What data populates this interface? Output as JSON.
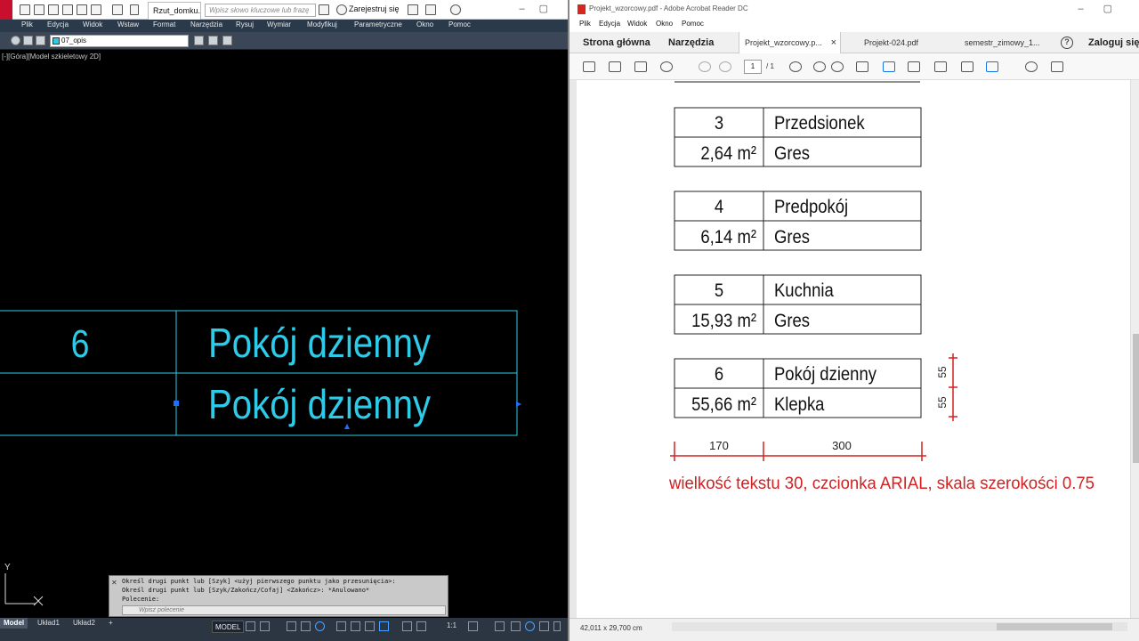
{
  "autocad": {
    "doc_tab": "Rzut_domku...",
    "search_placeholder": "Wpisz słowo kluczowe lub frazę",
    "signin": "Zarejestruj się",
    "menu": [
      "Plik",
      "Edycja",
      "Widok",
      "Wstaw",
      "Format",
      "Narzędzia",
      "Rysuj",
      "Wymiar",
      "Modyfikuj",
      "Parametryczne",
      "Okno",
      "Pomoc"
    ],
    "layer": "07_opis",
    "viewport_label": "[-][Góra][Model szkieletowy 2D]",
    "table": {
      "number": "6",
      "name": "Pokój dzienny",
      "name2": "Pokój dzienny"
    },
    "ucs": {
      "y": "Y",
      "x": "X"
    },
    "command_lines": [
      "Określ drugi punkt lub [Szyk] <użyj pierwszego punktu jako przesunięcia>:",
      "Określ drugi punkt lub [Szyk/Zakończ/Cofaj] <Zakończ>: *Anulowano*",
      "Polecenie:"
    ],
    "command_placeholder": "Wpisz polecenie",
    "layout_tabs": [
      "Model",
      "Układ1",
      "Układ2"
    ],
    "add_tab": "+",
    "model_button": "MODEL",
    "scale": "1:1",
    "accent_color": "#2ecbe8"
  },
  "acrobat": {
    "title": "Projekt_wzorcowy.pdf - Adobe Acrobat Reader DC",
    "menu": [
      "Plik",
      "Edycja",
      "Widok",
      "Okno",
      "Pomoc"
    ],
    "tabs": {
      "home": "Strona główna",
      "tools": "Narzędzia",
      "doc": "Projekt_wzorcowy.p...",
      "close": "×",
      "doc2": "Projekt-024.pdf",
      "doc3": "semestr_zimowy_1...",
      "signin": "Zaloguj się"
    },
    "page_current": "1",
    "page_total": "/ 1",
    "page_size": "42,011 x 29,700 cm",
    "rooms": [
      {
        "no": "3",
        "name": "Przedsionek",
        "area": "2,64 m²",
        "floor": "Gres"
      },
      {
        "no": "4",
        "name": "Predpokój",
        "area": "6,14 m²",
        "floor": "Gres"
      },
      {
        "no": "5",
        "name": "Kuchnia",
        "area": "15,93 m²",
        "floor": "Gres"
      },
      {
        "no": "6",
        "name": "Pokój dzienny",
        "area": "55,66 m²",
        "floor": "Klepka"
      }
    ],
    "dims": {
      "w1": "170",
      "w2": "300",
      "h1": "55",
      "h2": "55"
    },
    "note": "wielkość tekstu 30, czcionka ARIAL, skala szerokości 0.75",
    "note_color": "#d42020"
  }
}
